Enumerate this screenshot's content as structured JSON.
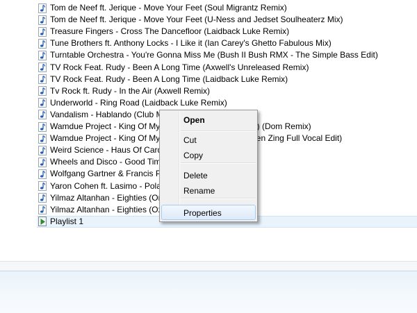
{
  "files": [
    {
      "name": "Tom de Neef ft. Jerique - Move Your Feet (Soul Migrantz Remix)",
      "icon": "audio-file-icon"
    },
    {
      "name": "Tom de Neef ft. Jerique - Move Your Feet (U-Ness and Jedset Soulheaterz Mix)",
      "icon": "audio-file-icon"
    },
    {
      "name": "Treasure Fingers - Cross The Dancefloor (Laidback Luke Remix)",
      "icon": "audio-file-icon"
    },
    {
      "name": "Tune Brothers ft. Anthony Locks - I Like it (Ian Carey's Ghetto Fabulous Mix)",
      "icon": "audio-file-icon"
    },
    {
      "name": "Turntable Orchestra - You're Gonna Miss Me (Bush II Bush RMX - The Simple Bass Edit)",
      "icon": "audio-file-icon"
    },
    {
      "name": "TV Rock Feat. Rudy - Been A Long Time (Axwell's Unreleased Remix)",
      "icon": "audio-file-icon"
    },
    {
      "name": "TV Rock Feat. Rudy - Been A Long Time (Laidback Luke Remix)",
      "icon": "audio-file-icon"
    },
    {
      "name": "Tv Rock ft. Rudy - In the Air (Axwell Remix)",
      "icon": "audio-file-icon"
    },
    {
      "name": "Underworld - Ring Road (Laidback Luke Remix)",
      "icon": "audio-file-icon"
    },
    {
      "name": "Vandalism - Hablando (Club Mix)",
      "icon": "audio-file-icon"
    },
    {
      "name": "Wamdue Project - King Of My Castle (Roy Malakian Mix) (Dom Remix)",
      "icon": "audio-file-icon"
    },
    {
      "name": "Wamdue Project - King Of My Castle (Armand Van Helden Zing Full Vocal Edit)",
      "icon": "audio-file-icon"
    },
    {
      "name": "Weird Science - Haus Of Cards",
      "icon": "audio-file-icon"
    },
    {
      "name": "Wheels and Disco - Good Times",
      "icon": "audio-file-icon"
    },
    {
      "name": "Wolfgang Gartner & Francis Preve",
      "icon": "audio-file-icon"
    },
    {
      "name": "Yaron Cohen ft. Lasimo - Polaroid (Ricky Fobis Remix)",
      "icon": "audio-file-icon"
    },
    {
      "name": "Yilmaz Altanhan - Eighties (Original Mix)",
      "icon": "audio-file-icon"
    },
    {
      "name": "Yilmaz Altanhan - Eighties (Ozgur Can Remix)",
      "icon": "audio-file-icon"
    },
    {
      "name": "Playlist 1",
      "icon": "playlist-file-icon",
      "selected": true
    }
  ],
  "context_menu": {
    "items": [
      {
        "label": "Open",
        "bold": true
      },
      {
        "separator": true
      },
      {
        "label": "Cut"
      },
      {
        "label": "Copy"
      },
      {
        "separator": true
      },
      {
        "label": "Delete"
      },
      {
        "label": "Rename"
      },
      {
        "separator": true
      },
      {
        "label": "Properties",
        "hovered": true
      }
    ]
  },
  "colors": {
    "selection_bg": "#e9f3fc",
    "menu_bg": "#f0f0f0",
    "menu_hover_border": "#a8cbf1",
    "note_icon": "#1d5cb8",
    "playlist_icon": "#2e8b2e"
  }
}
